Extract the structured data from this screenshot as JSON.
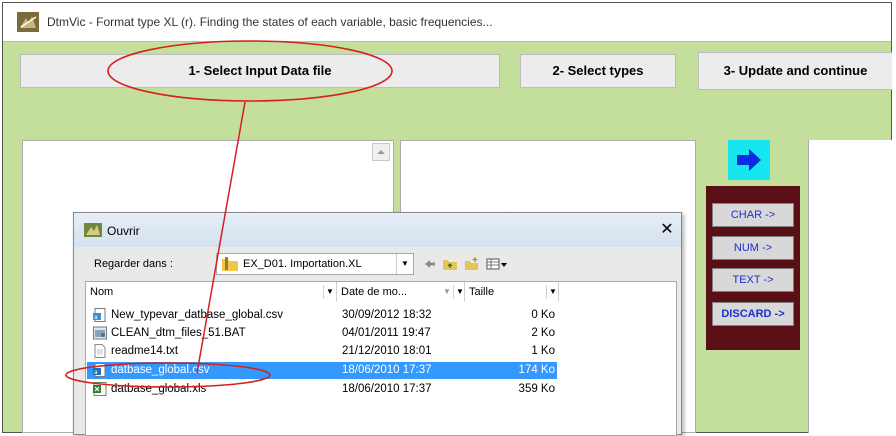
{
  "window": {
    "title": "DtmVic - Format type XL (r). Finding the states of each variable, basic frequencies..."
  },
  "toolbar": {
    "step1_label": "1- Select Input Data file",
    "step2_label": "2- Select types",
    "step3_label": "3- Update and continue"
  },
  "types": {
    "char_label": "CHAR ->",
    "num_label": "NUM ->",
    "text_label": "TEXT ->",
    "discard_label": "DISCARD ->"
  },
  "dialog": {
    "title": "Ouvrir",
    "close_glyph": "✕",
    "lookin_label": "Regarder dans :",
    "lookin_value": "EX_D01. Importation.XL",
    "columns": {
      "name": "Nom",
      "date": "Date de mo...",
      "size": "Taille"
    },
    "files": [
      {
        "name": "New_typevar_datbase_global.csv",
        "date": "30/09/2012 18:32",
        "size": "0 Ko",
        "icon": "csv-file-icon"
      },
      {
        "name": "CLEAN_dtm_files_51.BAT",
        "date": "04/01/2011 19:47",
        "size": "2 Ko",
        "icon": "bat-file-icon"
      },
      {
        "name": "readme14.txt",
        "date": "21/12/2010 18:01",
        "size": "1 Ko",
        "icon": "txt-file-icon"
      },
      {
        "name": "datbase_global.csv",
        "date": "18/06/2010 17:37",
        "size": "174 Ko",
        "icon": "csv-file-icon",
        "selected": true
      },
      {
        "name": "datbase_global.xls",
        "date": "18/06/2010 17:37",
        "size": "359 Ko",
        "icon": "xls-file-icon"
      }
    ]
  },
  "colors": {
    "background_green": "#c4df9b",
    "arrow_button": "#17e5ef",
    "type_panel": "#5a0e16",
    "selection": "#3399ff",
    "annotation": "#d42020"
  }
}
